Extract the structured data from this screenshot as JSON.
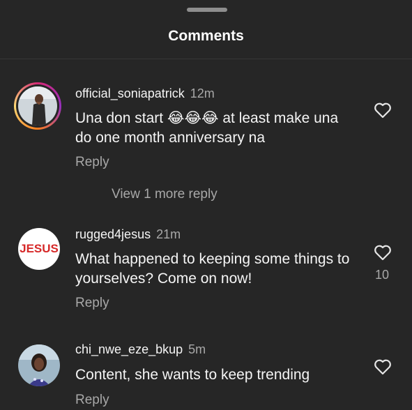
{
  "header": {
    "title": "Comments"
  },
  "comments": [
    {
      "username": "official_soniapatrick",
      "time": "12m",
      "text": "Una don start 😂😂😂 at least make una do one month anniversary na",
      "reply_label": "Reply",
      "likes": ""
    },
    {
      "username": "rugged4jesus",
      "time": "21m",
      "avatar_text": "JESUS",
      "text": "What happened to keeping some things to yourselves? Come on now!",
      "reply_label": "Reply",
      "likes": "10"
    },
    {
      "username": "chi_nwe_eze_bkup",
      "time": "5m",
      "text": "Content, she wants to keep trending",
      "reply_label": "Reply",
      "likes": ""
    }
  ],
  "view_more_replies": "View 1 more reply",
  "icons": {
    "heart": "heart-outline-icon",
    "drag_handle": "drag-handle-icon"
  },
  "colors": {
    "background": "#262626",
    "text": "#f5f5f5",
    "secondary": "#a8a8a8",
    "jesus_red": "#d62828"
  }
}
